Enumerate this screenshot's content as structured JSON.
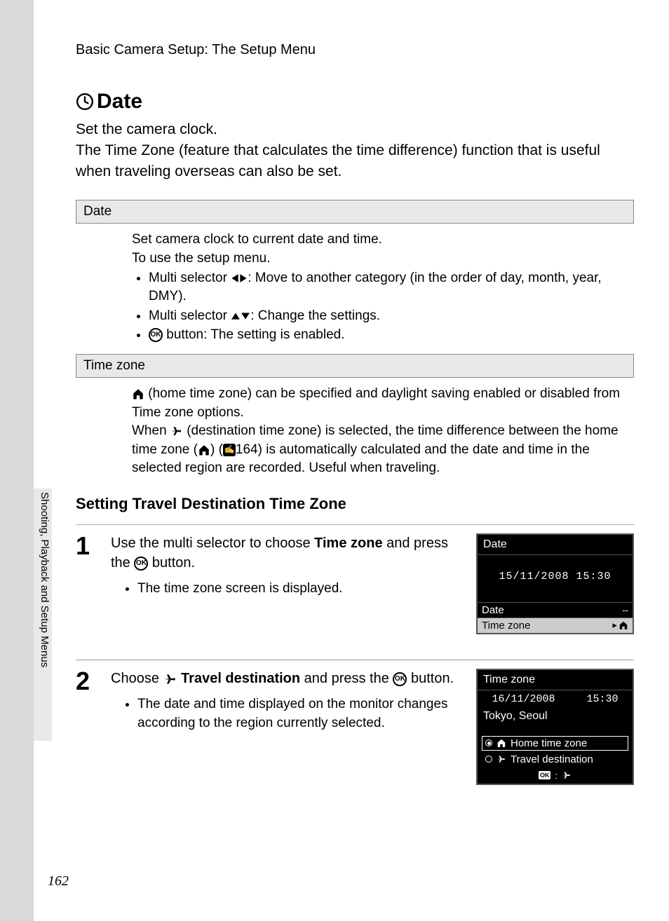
{
  "breadcrumb": "Basic Camera Setup: The Setup Menu",
  "h1": "Date",
  "intro": "Set the camera clock.\nThe Time Zone (feature that calculates the time difference) function that is useful when traveling overseas can also be set.",
  "date_table": {
    "header": "Date",
    "line1": "Set camera clock to current date and time.",
    "line2": "To use the setup menu.",
    "b1_pre": "Multi selector ",
    "b1_post": ":   Move to another category (in the order of day, month, year, DMY).",
    "b2_pre": "Multi selector ",
    "b2_post": ":   Change the settings.",
    "b3_post": " button: The setting is enabled."
  },
  "tz_table": {
    "header": "Time zone",
    "p1a": " (home time zone) can be specified and daylight saving enabled or disabled from Time zone options.",
    "p2a": "When ",
    "p2b": " (destination time zone) is selected, the time difference between the home time zone (",
    "p2c": ") (",
    "p2d": "164) is automatically calculated and the date and time in the selected region are recorded. Useful when traveling."
  },
  "h2": "Setting Travel Destination Time Zone",
  "step1": {
    "num": "1",
    "t1": "Use the multi selector to choose ",
    "t1b": "Time zone",
    "t2a": " and press the ",
    "t2b": " button.",
    "bullet": "The time zone screen is displayed."
  },
  "lcd1": {
    "title": "Date",
    "datetime": "15/11/2008 15:30",
    "row1l": "Date",
    "row1r": "--",
    "row2l": "Time zone"
  },
  "step2": {
    "num": "2",
    "t1": "Choose ",
    "t1b": " Travel destination",
    "t2a": " and press the ",
    "t2b": " button.",
    "bullet": "The date and time displayed on the monitor changes according to the region currently selected."
  },
  "lcd2": {
    "title": "Time zone",
    "date": "16/11/2008",
    "time": "15:30",
    "loc": "Tokyo, Seoul",
    "opt1": "Home time zone",
    "opt2": "Travel destination"
  },
  "side_label": "Shooting, Playback and Setup Menus",
  "page_number": "162",
  "ok_label": "OK",
  "colon": ":"
}
